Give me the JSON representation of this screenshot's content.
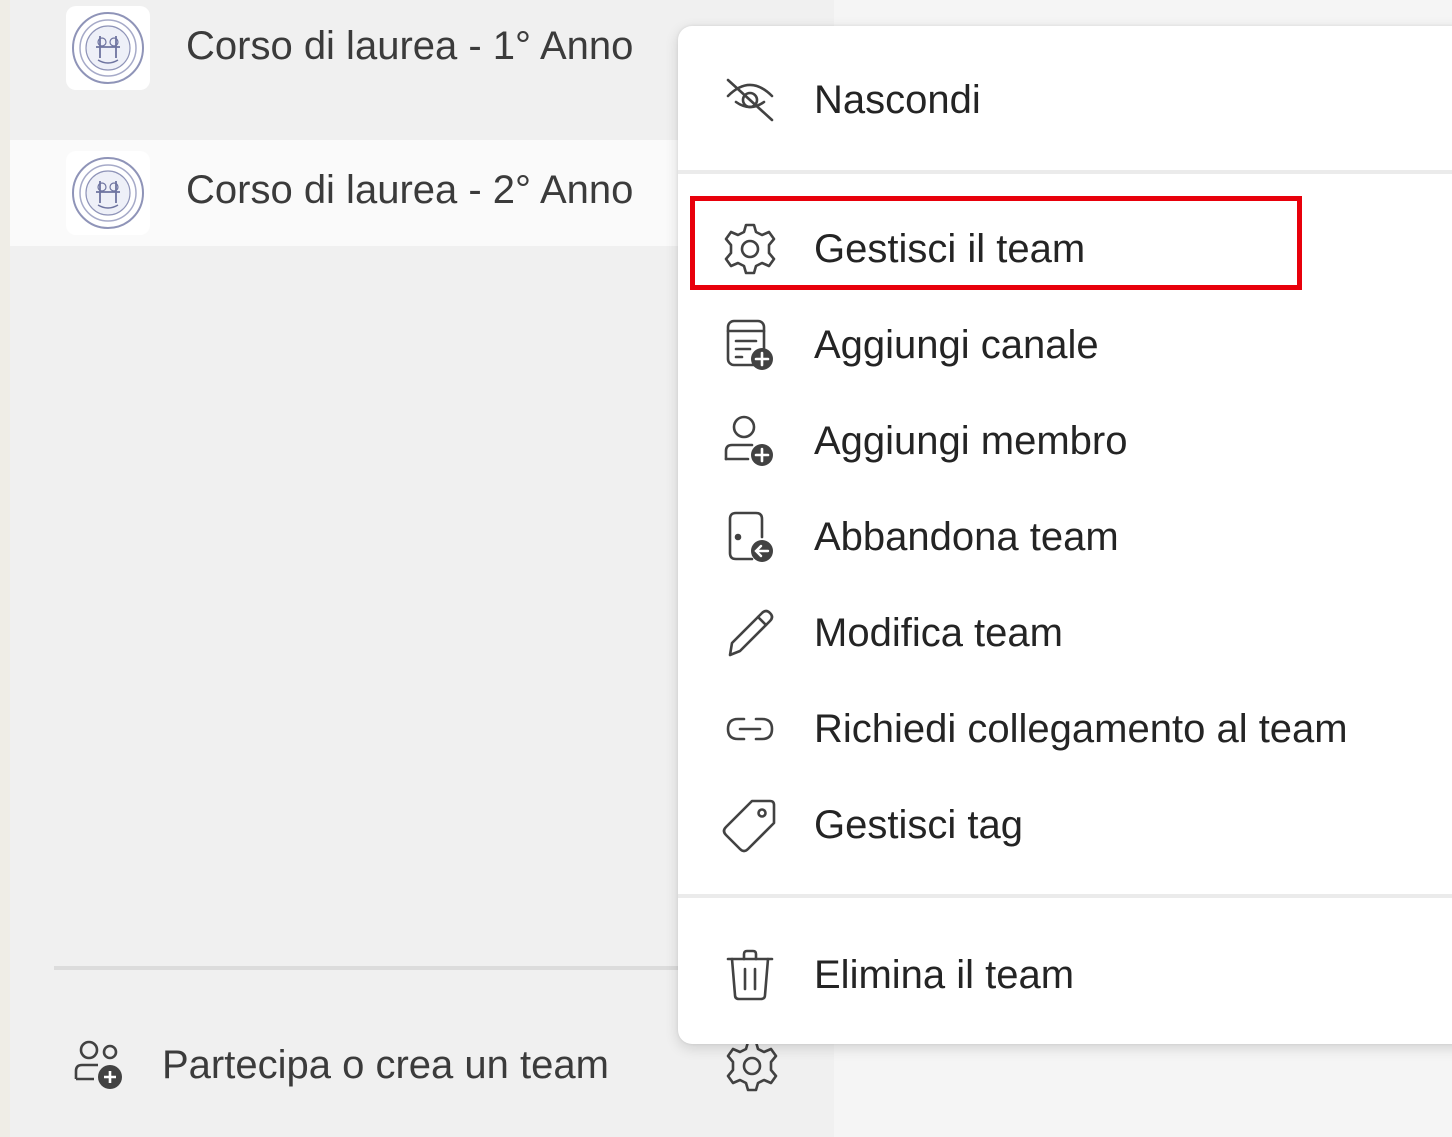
{
  "sidebar": {
    "teams": [
      {
        "name": "Corso di laurea - 1° Anno",
        "avatar_icon": "university-seal-icon"
      },
      {
        "name": "Corso di laurea - 2° Anno",
        "avatar_icon": "university-seal-icon"
      }
    ],
    "footer": {
      "join_label": "Partecipa o crea un team",
      "join_icon": "people-add-icon",
      "settings_icon": "gear-icon"
    }
  },
  "context_menu": {
    "items": [
      {
        "label": "Nascondi",
        "icon": "eye-off-icon"
      },
      {
        "label": "Gestisci il team",
        "icon": "gear-icon",
        "highlighted": true
      },
      {
        "label": "Aggiungi canale",
        "icon": "channel-add-icon"
      },
      {
        "label": "Aggiungi membro",
        "icon": "person-add-icon"
      },
      {
        "label": "Abbandona team",
        "icon": "door-leave-icon"
      },
      {
        "label": "Modifica team",
        "icon": "pencil-icon"
      },
      {
        "label": "Richiedi collegamento al team",
        "icon": "link-icon"
      },
      {
        "label": "Gestisci tag",
        "icon": "tag-icon"
      },
      {
        "label": "Elimina il team",
        "icon": "trash-icon"
      }
    ]
  },
  "colors": {
    "highlight_border": "#e8000b",
    "sidebar_bg": "#f0f0f0",
    "menu_bg": "#ffffff"
  }
}
